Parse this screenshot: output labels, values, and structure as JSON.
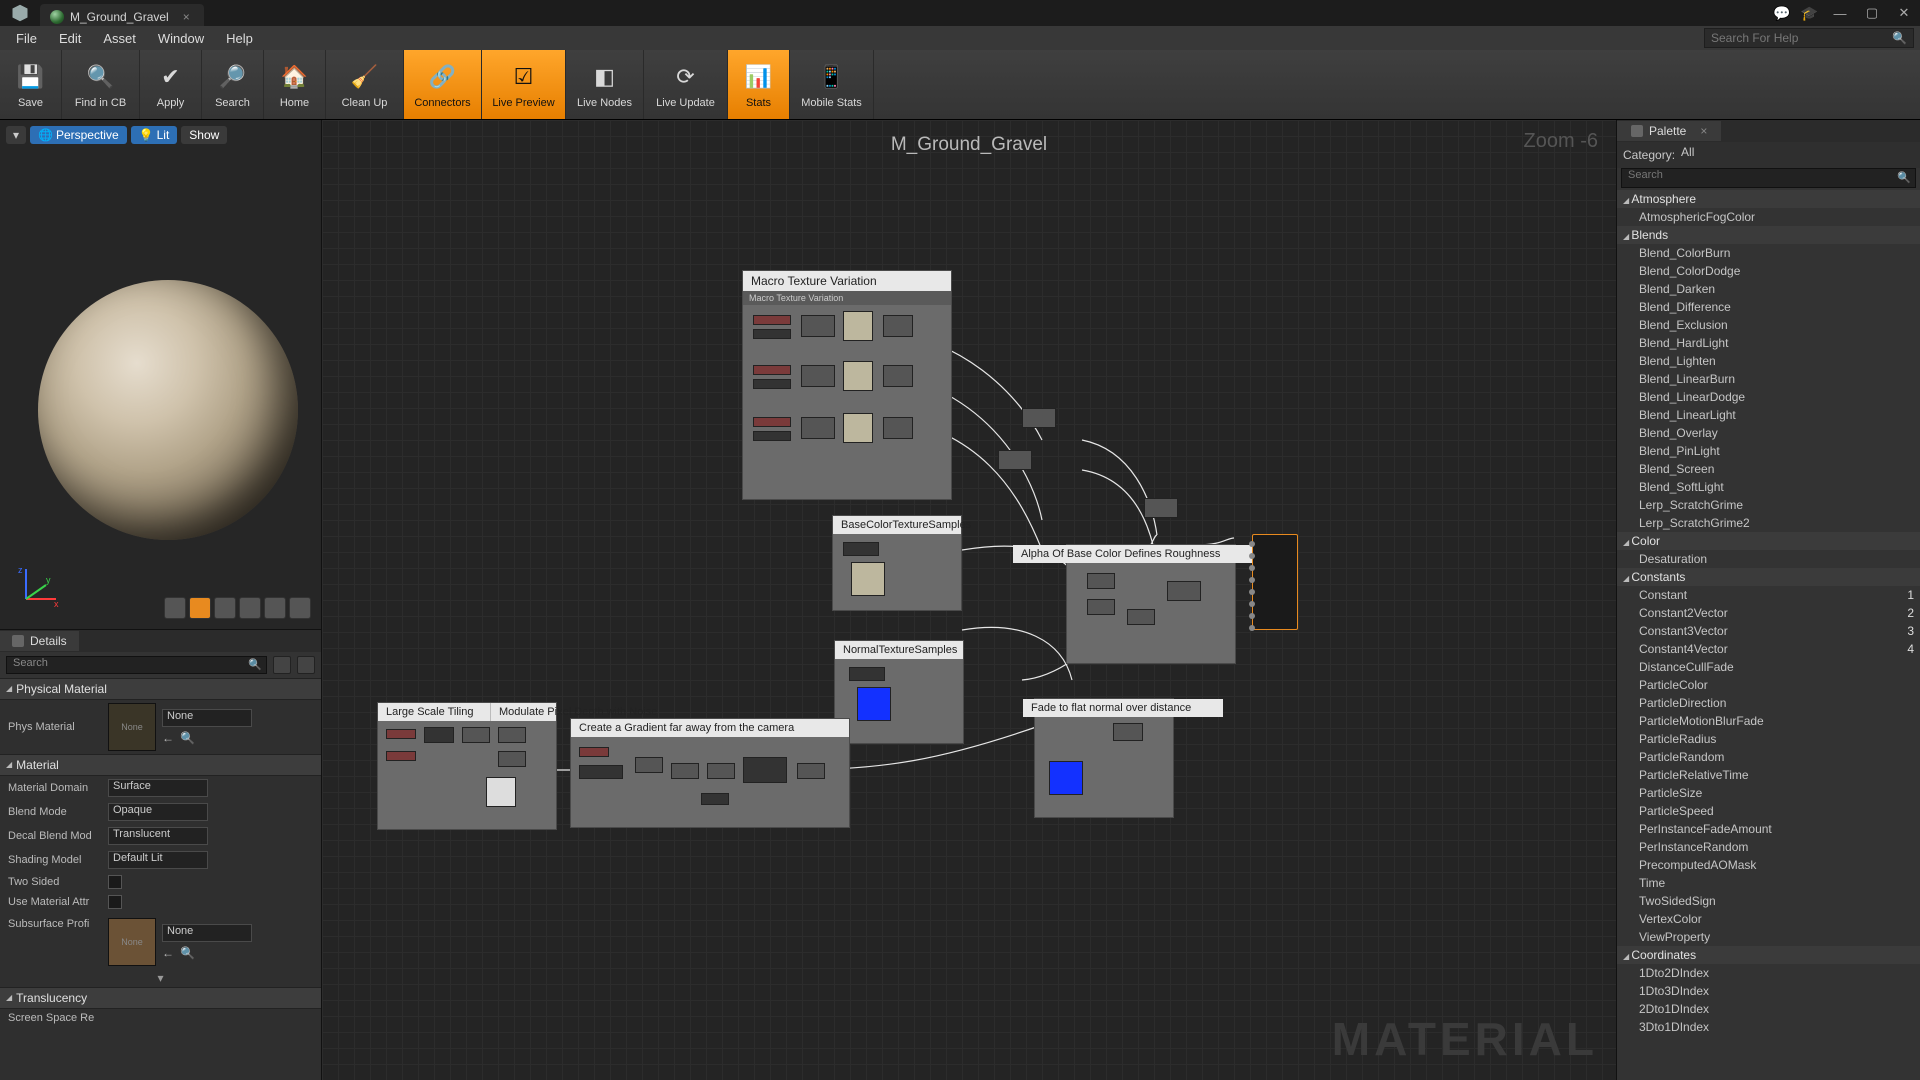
{
  "window": {
    "tab_title": "M_Ground_Gravel"
  },
  "menu": {
    "items": [
      "File",
      "Edit",
      "Asset",
      "Window",
      "Help"
    ],
    "search_placeholder": "Search For Help"
  },
  "toolbar": {
    "buttons": [
      {
        "label": "Save",
        "icon": "💾"
      },
      {
        "label": "Find in CB",
        "icon": "🔍"
      },
      {
        "label": "Apply",
        "icon": "✔"
      },
      {
        "label": "Search",
        "icon": "🔎"
      },
      {
        "label": "Home",
        "icon": "🏠"
      },
      {
        "label": "Clean Up",
        "icon": "🧹"
      },
      {
        "label": "Connectors",
        "icon": "🔗",
        "active": true
      },
      {
        "label": "Live Preview",
        "icon": "☑",
        "active": true
      },
      {
        "label": "Live Nodes",
        "icon": "◧"
      },
      {
        "label": "Live Update",
        "icon": "⟳"
      },
      {
        "label": "Stats",
        "icon": "📊",
        "active": true
      },
      {
        "label": "Mobile Stats",
        "icon": "📱"
      }
    ]
  },
  "viewport": {
    "dropdown": "▾",
    "perspective": "Perspective",
    "lit": "Lit",
    "show": "Show"
  },
  "details": {
    "tab": "Details",
    "search_placeholder": "Search",
    "sections": {
      "physical": {
        "title": "Physical Material",
        "phys_label": "Phys Material",
        "thumb_text": "None",
        "picker_value": "None"
      },
      "material": {
        "title": "Material",
        "rows": {
          "domain_label": "Material Domain",
          "domain_value": "Surface",
          "blend_label": "Blend Mode",
          "blend_value": "Opaque",
          "decal_label": "Decal Blend Mod",
          "decal_value": "Translucent",
          "shading_label": "Shading Model",
          "shading_value": "Default Lit",
          "twosided_label": "Two Sided",
          "useattr_label": "Use Material Attr",
          "subsurf_label": "Subsurface Profi",
          "subsurf_thumb": "None",
          "subsurf_value": "None"
        }
      },
      "translucency": {
        "title": "Translucency",
        "row0": "Screen Space Re"
      }
    }
  },
  "graph": {
    "title": "M_Ground_Gravel",
    "zoom": "Zoom -6",
    "watermark": "MATERIAL",
    "groups": {
      "macro": {
        "title": "Macro Texture Variation",
        "sub": "Macro Texture Variation"
      },
      "basecolor": {
        "title": "BaseColorTextureSamples"
      },
      "alpha": {
        "title": "Alpha Of Base Color Defines Roughness"
      },
      "normal": {
        "title": "NormalTextureSamples"
      },
      "fade": {
        "title": "Fade to flat normal over distance"
      },
      "tiling": {
        "title": "Large Scale Tiling"
      },
      "noise": {
        "title": "Modulate Pixel Depth with Noise"
      },
      "gradient": {
        "title": "Create a Gradient far away from the camera"
      }
    }
  },
  "palette": {
    "tab": "Palette",
    "category_label": "Category:",
    "category_value": "All",
    "search_placeholder": "Search",
    "categories": [
      {
        "name": "Atmosphere",
        "items": [
          {
            "label": "AtmosphericFogColor"
          }
        ]
      },
      {
        "name": "Blends",
        "items": [
          {
            "label": "Blend_ColorBurn"
          },
          {
            "label": "Blend_ColorDodge"
          },
          {
            "label": "Blend_Darken"
          },
          {
            "label": "Blend_Difference"
          },
          {
            "label": "Blend_Exclusion"
          },
          {
            "label": "Blend_HardLight"
          },
          {
            "label": "Blend_Lighten"
          },
          {
            "label": "Blend_LinearBurn"
          },
          {
            "label": "Blend_LinearDodge"
          },
          {
            "label": "Blend_LinearLight"
          },
          {
            "label": "Blend_Overlay"
          },
          {
            "label": "Blend_PinLight"
          },
          {
            "label": "Blend_Screen"
          },
          {
            "label": "Blend_SoftLight"
          },
          {
            "label": "Lerp_ScratchGrime"
          },
          {
            "label": "Lerp_ScratchGrime2"
          }
        ]
      },
      {
        "name": "Color",
        "items": [
          {
            "label": "Desaturation"
          }
        ]
      },
      {
        "name": "Constants",
        "items": [
          {
            "label": "Constant",
            "shortcut": "1"
          },
          {
            "label": "Constant2Vector",
            "shortcut": "2"
          },
          {
            "label": "Constant3Vector",
            "shortcut": "3"
          },
          {
            "label": "Constant4Vector",
            "shortcut": "4"
          },
          {
            "label": "DistanceCullFade"
          },
          {
            "label": "ParticleColor"
          },
          {
            "label": "ParticleDirection"
          },
          {
            "label": "ParticleMotionBlurFade"
          },
          {
            "label": "ParticleRadius"
          },
          {
            "label": "ParticleRandom"
          },
          {
            "label": "ParticleRelativeTime"
          },
          {
            "label": "ParticleSize"
          },
          {
            "label": "ParticleSpeed"
          },
          {
            "label": "PerInstanceFadeAmount"
          },
          {
            "label": "PerInstanceRandom"
          },
          {
            "label": "PrecomputedAOMask"
          },
          {
            "label": "Time"
          },
          {
            "label": "TwoSidedSign"
          },
          {
            "label": "VertexColor"
          },
          {
            "label": "ViewProperty"
          }
        ]
      },
      {
        "name": "Coordinates",
        "items": [
          {
            "label": "1Dto2DIndex"
          },
          {
            "label": "1Dto3DIndex"
          },
          {
            "label": "2Dto1DIndex"
          },
          {
            "label": "3Dto1DIndex"
          }
        ]
      }
    ]
  }
}
